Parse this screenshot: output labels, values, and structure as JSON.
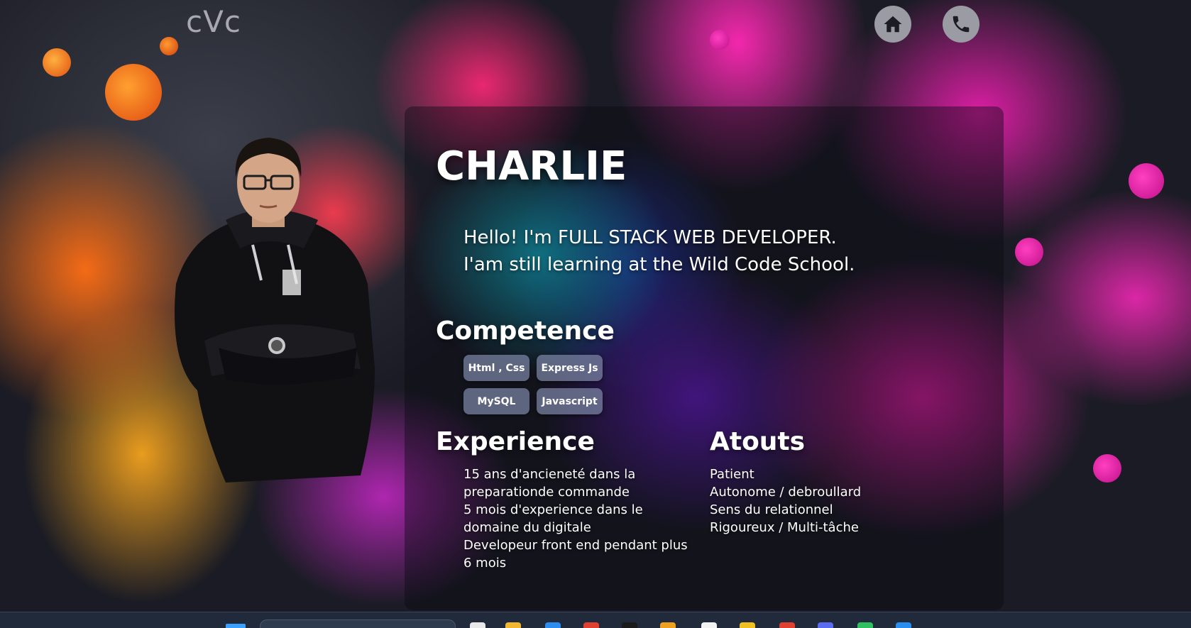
{
  "header": {
    "logo": "cVc",
    "nav": [
      {
        "icon": "home-icon"
      },
      {
        "icon": "phone-icon"
      }
    ]
  },
  "profile": {
    "name": "CHARLIE",
    "intro_line1": "Hello! I'm FULL STACK WEB DEVELOPER.",
    "intro_line2": "I'am still learning at the Wild Code School."
  },
  "competence": {
    "title": "Competence",
    "skills": [
      "Html , Css",
      "Express Js",
      "MySQL",
      "Javascript"
    ]
  },
  "experience": {
    "title": "Experience",
    "items": [
      "15 ans d'ancieneté dans la preparationde commande",
      "5 mois d'experience dans le domaine du digitale",
      "Developeur front end pendant plus 6 mois"
    ]
  },
  "atouts": {
    "title": "Atouts",
    "items": [
      "Patient",
      "Autonome / debroullard",
      "Sens du relationnel",
      "Rigoureux / Multi-tâche"
    ]
  },
  "colors": {
    "accent_magenta": "#e01eaa",
    "accent_orange": "#ff6e14",
    "accent_cyan": "#14bed2",
    "nav_button": "#9a9ba3",
    "taskbar": "#202a3a"
  }
}
